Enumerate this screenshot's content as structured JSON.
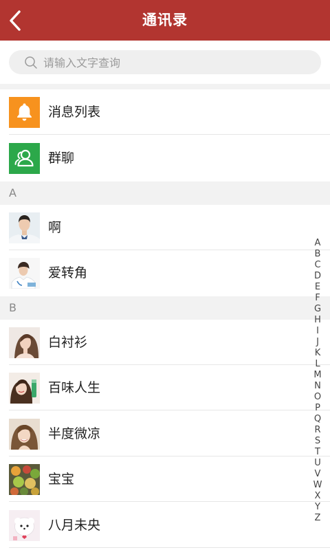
{
  "header": {
    "title": "通讯录",
    "back_icon": "chevron-left-icon",
    "background_color": "#b23530"
  },
  "search": {
    "placeholder": "请输入文字查询",
    "icon": "search-icon"
  },
  "top_items": [
    {
      "label": "消息列表",
      "icon": "bell-icon",
      "color": "#f7921e"
    },
    {
      "label": "群聊",
      "icon": "group-icon",
      "color": "#2ca84a"
    }
  ],
  "sections": [
    {
      "letter": "A",
      "contacts": [
        "啊",
        "爱转角"
      ]
    },
    {
      "letter": "B",
      "contacts": [
        "白衬衫",
        "百味人生",
        "半度微凉",
        "宝宝",
        "八月未央"
      ]
    }
  ],
  "index_letters": [
    "A",
    "B",
    "C",
    "D",
    "E",
    "F",
    "G",
    "H",
    "I",
    "J",
    "K",
    "L",
    "M",
    "N",
    "O",
    "P",
    "Q",
    "R",
    "S",
    "T",
    "U",
    "V",
    "W",
    "X",
    "Y",
    "Z"
  ]
}
